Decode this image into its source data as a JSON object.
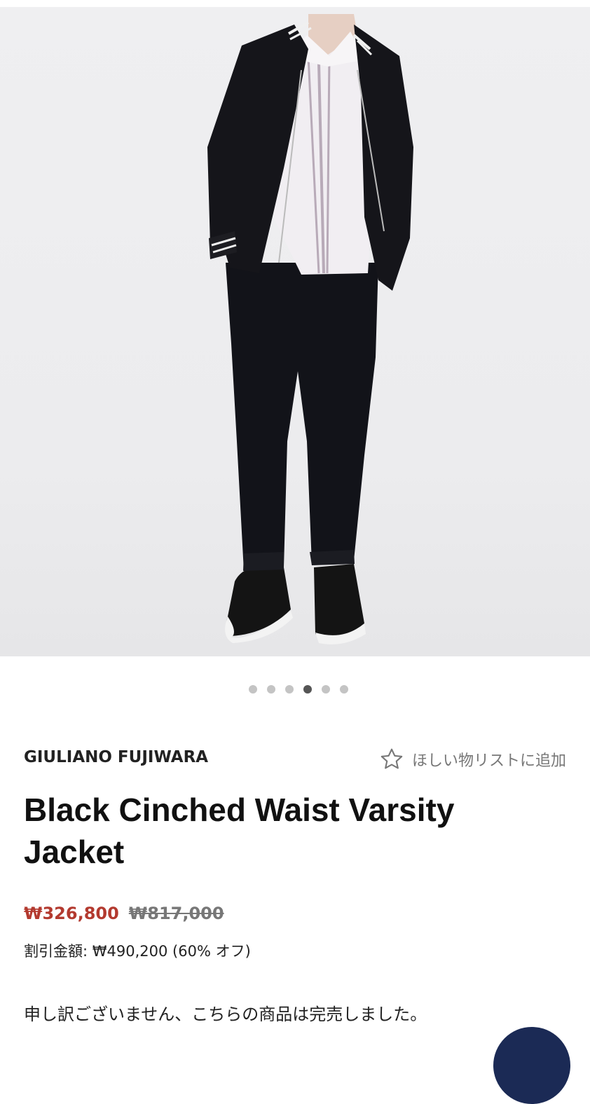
{
  "carousel": {
    "count": 6,
    "active_index": 3
  },
  "product": {
    "brand": "GIULIANO FUJIWARA",
    "title": "Black Cinched Waist Varsity Jacket",
    "sale_price": "₩326,800",
    "original_price": "₩817,000",
    "discount_label": "割引金額: ₩490,200 (60% オフ)",
    "soldout_message": "申し訳ございません、こちらの商品は完売しました。"
  },
  "wishlist": {
    "label": "ほしい物リストに追加",
    "icon": "star-outline-icon"
  },
  "colors": {
    "sale": "#b33a2f",
    "fab": "#1b2a55"
  }
}
